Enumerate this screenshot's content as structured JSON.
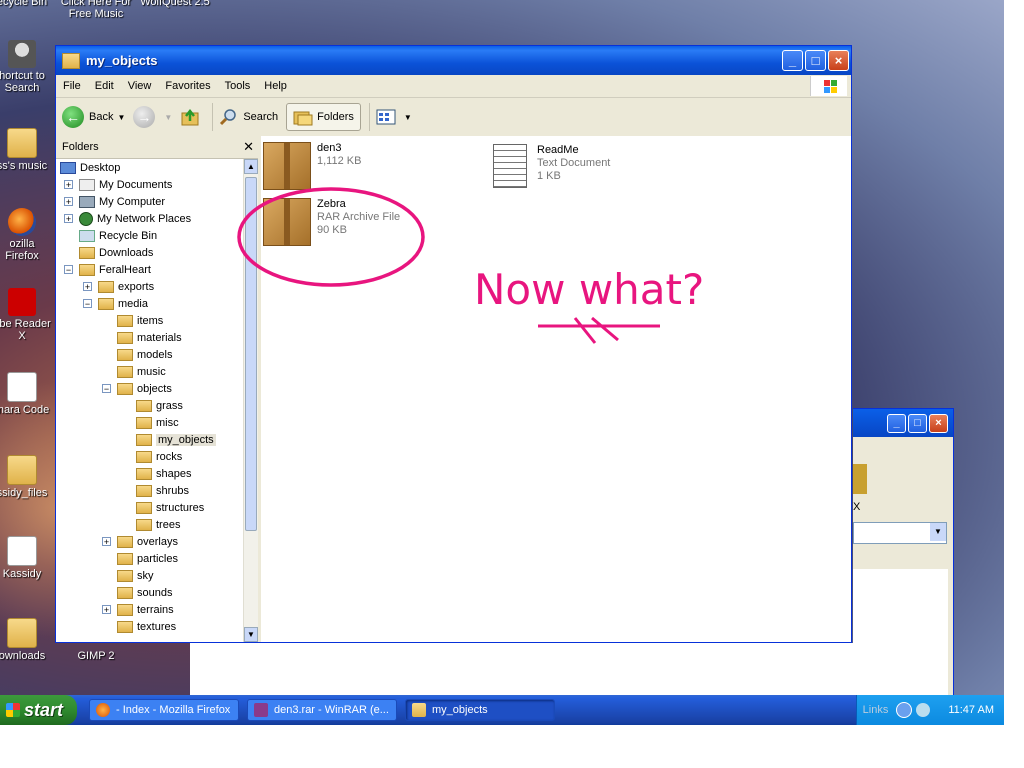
{
  "desktop": {
    "icons": [
      {
        "label": "ecycle Bin"
      },
      {
        "label": "Click Here For Free Music"
      },
      {
        "label": "WolfQuest 2.5"
      },
      {
        "label": "hortcut to Search"
      },
      {
        "label": "ss's music"
      },
      {
        "label": "ozilla Firefox"
      },
      {
        "label": "obe Reader X"
      },
      {
        "label": "mara Code"
      },
      {
        "label": "ssidy_files"
      },
      {
        "label": "Kassidy"
      },
      {
        "label": "ownloads"
      },
      {
        "label": "GIMP 2"
      }
    ]
  },
  "window": {
    "title": "my_objects",
    "menu": [
      "File",
      "Edit",
      "View",
      "Favorites",
      "Tools",
      "Help"
    ],
    "toolbar": {
      "back": "Back",
      "search": "Search",
      "folders": "Folders"
    },
    "folders_pane": {
      "header": "Folders",
      "tree": [
        {
          "label": "Desktop",
          "depth": 0,
          "toggle": "",
          "kind": "desk"
        },
        {
          "label": "My Documents",
          "depth": 1,
          "toggle": "+",
          "kind": "doc"
        },
        {
          "label": "My Computer",
          "depth": 1,
          "toggle": "+",
          "kind": "pc"
        },
        {
          "label": "My Network Places",
          "depth": 1,
          "toggle": "+",
          "kind": "net"
        },
        {
          "label": "Recycle Bin",
          "depth": 1,
          "toggle": "",
          "kind": "bin"
        },
        {
          "label": "Downloads",
          "depth": 1,
          "toggle": "",
          "kind": "folder"
        },
        {
          "label": "FeralHeart",
          "depth": 1,
          "toggle": "−",
          "kind": "folder"
        },
        {
          "label": "exports",
          "depth": 2,
          "toggle": "+",
          "kind": "folder"
        },
        {
          "label": "media",
          "depth": 2,
          "toggle": "−",
          "kind": "folder"
        },
        {
          "label": "items",
          "depth": 3,
          "toggle": "",
          "kind": "folder"
        },
        {
          "label": "materials",
          "depth": 3,
          "toggle": "",
          "kind": "folder"
        },
        {
          "label": "models",
          "depth": 3,
          "toggle": "",
          "kind": "folder"
        },
        {
          "label": "music",
          "depth": 3,
          "toggle": "",
          "kind": "folder"
        },
        {
          "label": "objects",
          "depth": 3,
          "toggle": "−",
          "kind": "folder"
        },
        {
          "label": "grass",
          "depth": 4,
          "toggle": "",
          "kind": "folder"
        },
        {
          "label": "misc",
          "depth": 4,
          "toggle": "",
          "kind": "folder"
        },
        {
          "label": "my_objects",
          "depth": 4,
          "toggle": "",
          "kind": "folder",
          "selected": true
        },
        {
          "label": "rocks",
          "depth": 4,
          "toggle": "",
          "kind": "folder"
        },
        {
          "label": "shapes",
          "depth": 4,
          "toggle": "",
          "kind": "folder"
        },
        {
          "label": "shrubs",
          "depth": 4,
          "toggle": "",
          "kind": "folder"
        },
        {
          "label": "structures",
          "depth": 4,
          "toggle": "",
          "kind": "folder"
        },
        {
          "label": "trees",
          "depth": 4,
          "toggle": "",
          "kind": "folder"
        },
        {
          "label": "overlays",
          "depth": 3,
          "toggle": "+",
          "kind": "folder"
        },
        {
          "label": "particles",
          "depth": 3,
          "toggle": "",
          "kind": "folder"
        },
        {
          "label": "sky",
          "depth": 3,
          "toggle": "",
          "kind": "folder"
        },
        {
          "label": "sounds",
          "depth": 3,
          "toggle": "",
          "kind": "folder"
        },
        {
          "label": "terrains",
          "depth": 3,
          "toggle": "+",
          "kind": "folder"
        },
        {
          "label": "textures",
          "depth": 3,
          "toggle": "",
          "kind": "folder"
        }
      ]
    },
    "files": [
      {
        "name": "den3",
        "type": "",
        "size": "1,112 KB",
        "icon": "archive"
      },
      {
        "name": "ReadMe",
        "type": "Text Document",
        "size": "1 KB",
        "icon": "notepad"
      },
      {
        "name": "Zebra",
        "type": "RAR Archive File",
        "size": "90 KB",
        "icon": "archive"
      }
    ],
    "annotation": "Now what?",
    "annotation_color": "#e8157f"
  },
  "back_window": {
    "label": "X"
  },
  "taskbar": {
    "start": "start",
    "tasks": [
      "- Index - Mozilla Firefox",
      "den3.rar - WinRAR (e...",
      "my_objects"
    ],
    "links": "Links",
    "clock": "11:47 AM"
  }
}
